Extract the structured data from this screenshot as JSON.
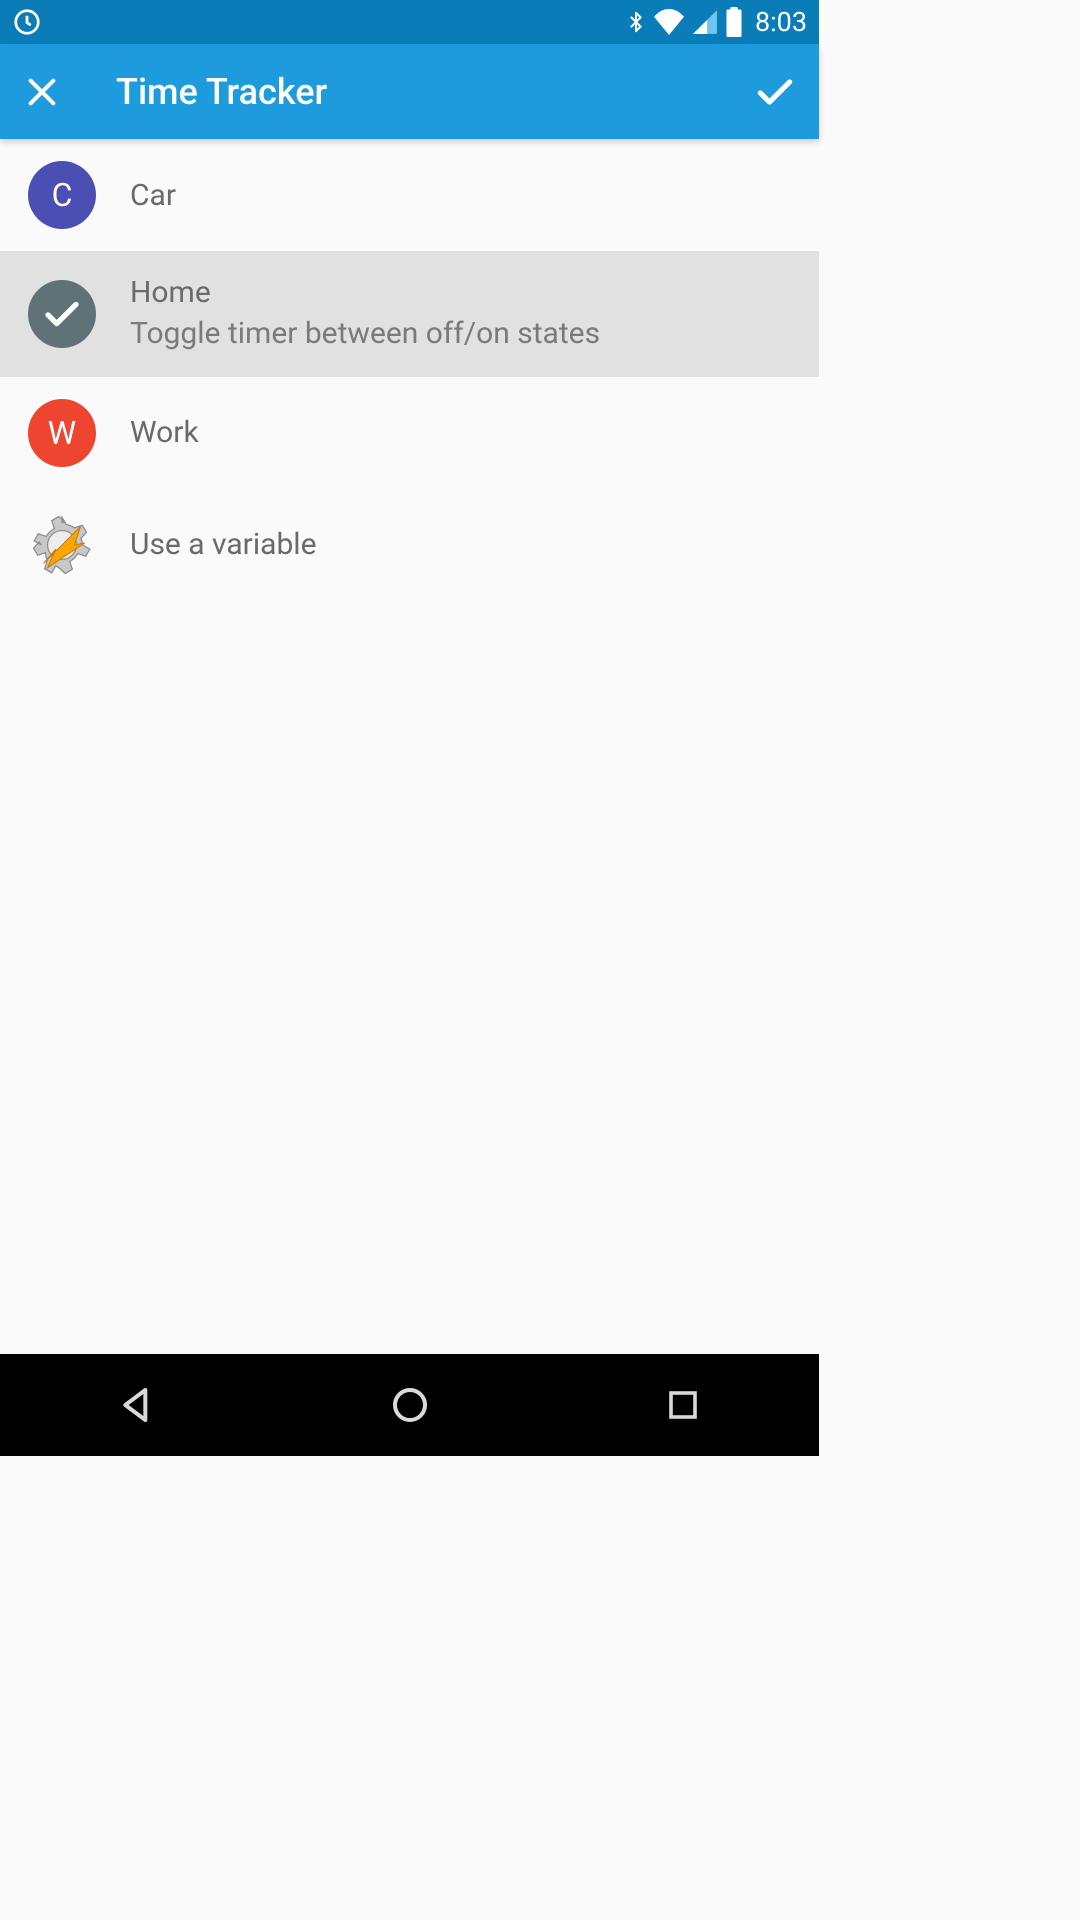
{
  "status_bar": {
    "time": "8:03"
  },
  "app_bar": {
    "title": "Time Tracker"
  },
  "list": {
    "items": [
      {
        "title": "Car",
        "subtitle": "",
        "avatar_letter": "C",
        "avatar_color": "#4b4fb3",
        "selected": false
      },
      {
        "title": "Home",
        "subtitle": "Toggle timer between off/on states",
        "avatar_letter": "",
        "avatar_color": "#5e7278",
        "selected": true
      },
      {
        "title": "Work",
        "subtitle": "",
        "avatar_letter": "W",
        "avatar_color": "#ee4530",
        "selected": false
      },
      {
        "title": "Use a variable",
        "subtitle": "",
        "avatar_letter": "",
        "avatar_color": "",
        "selected": false,
        "is_gear": true
      }
    ]
  }
}
